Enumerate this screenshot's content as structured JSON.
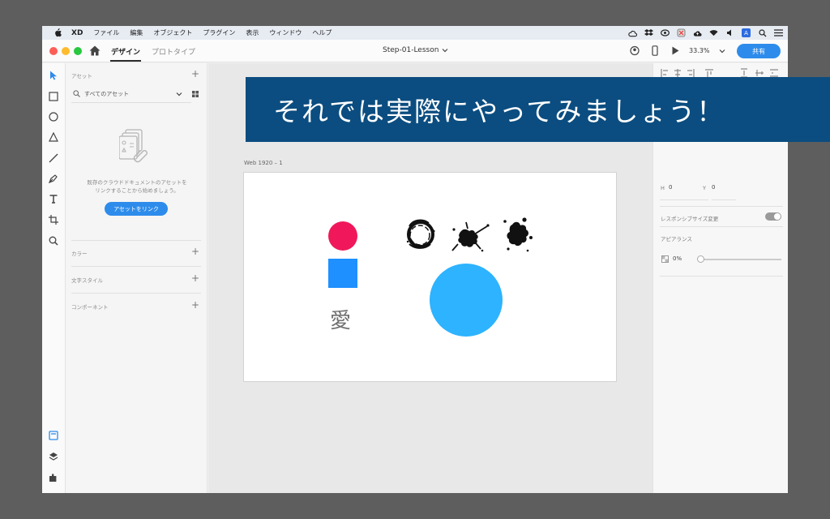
{
  "menubar": {
    "app_name": "XD",
    "items": [
      "ファイル",
      "編集",
      "オブジェクト",
      "プラグイン",
      "表示",
      "ウィンドウ",
      "ヘルプ"
    ],
    "input_badge": "A"
  },
  "toolbar": {
    "tab_design": "デザイン",
    "tab_prototype": "プロトタイプ",
    "document_title": "Step-01-Lesson",
    "zoom": "33.3%",
    "share_label": "共有"
  },
  "assets": {
    "header": "アセット",
    "filter_label": "すべてのアセット",
    "empty_message_line1": "既存のクラウドドキュメントのアセットを",
    "empty_message_line2": "リンクすることから始めましょう。",
    "link_button": "アセットをリンク",
    "sections": [
      "カラー",
      "文字スタイル",
      "コンポーネント"
    ]
  },
  "canvas": {
    "artboard_label": "Web 1920 – 1",
    "kanji": "愛"
  },
  "properties": {
    "h_label": "H",
    "h_value": "0",
    "y_label": "Y",
    "y_value": "0",
    "responsive_label": "レスポンシブサイズ変更",
    "appearance_label": "アピアランス",
    "opacity_value": "0%"
  },
  "banner": {
    "text": "それでは実際にやってみましょう！"
  },
  "colors": {
    "accent_blue": "#2d8ceb",
    "red_circle": "#f0185a",
    "blue_square": "#1e90ff",
    "big_circle": "#2db3ff",
    "banner_bg": "#0b4d80"
  }
}
